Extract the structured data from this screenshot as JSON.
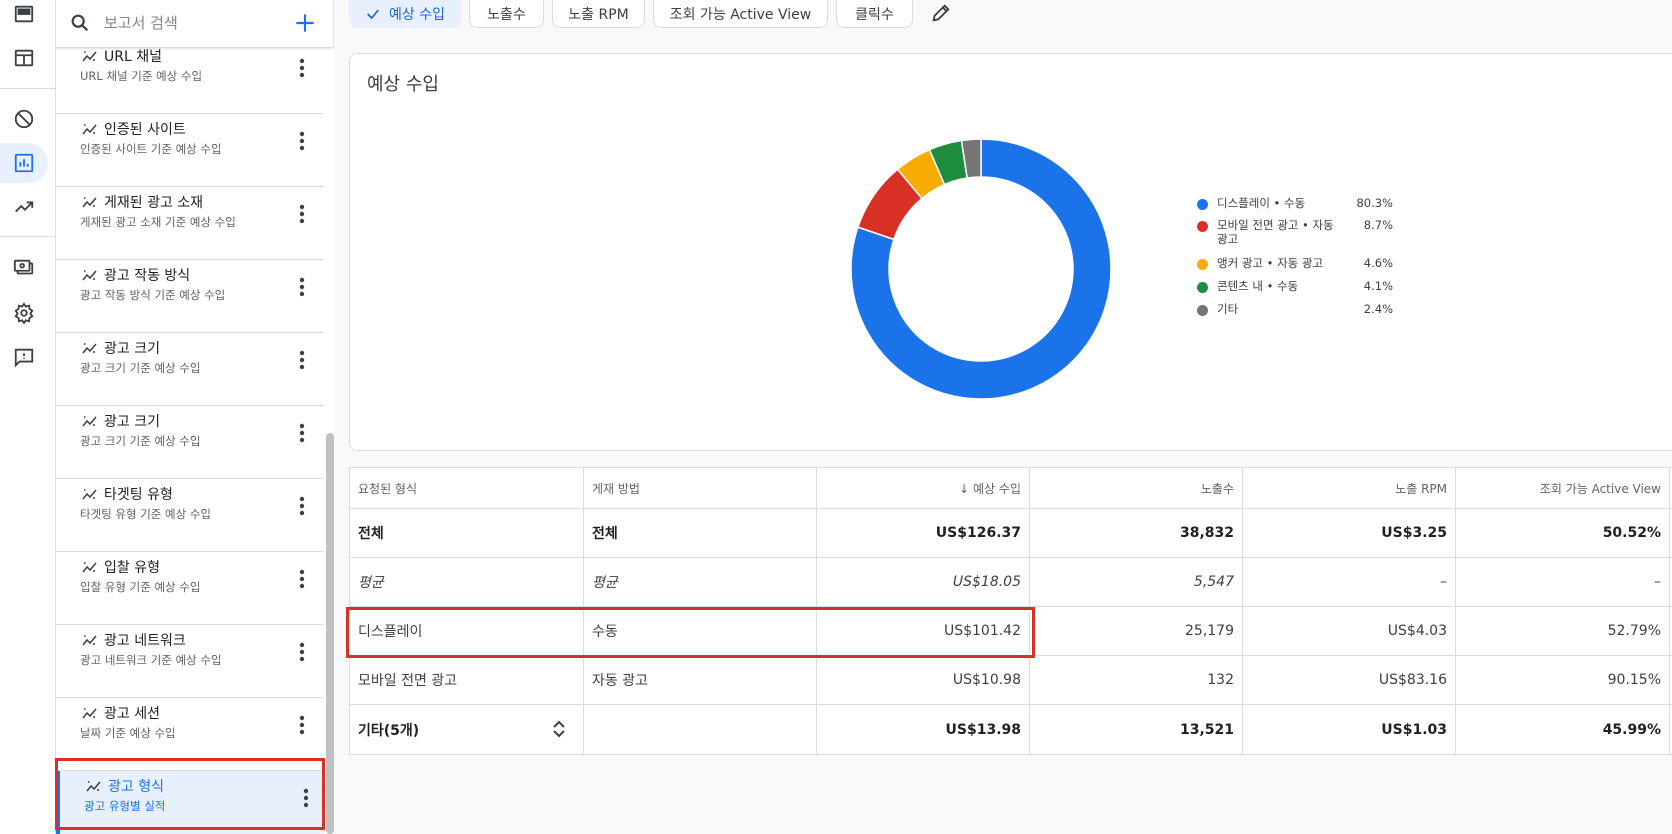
{
  "search": {
    "placeholder": "보고서 검색"
  },
  "reports": [
    {
      "title": "URL 채널",
      "subtitle": "URL 채널 기준 예상 수입"
    },
    {
      "title": "인증된 사이트",
      "subtitle": "인증된 사이트 기준 예상 수입"
    },
    {
      "title": "게재된 광고 소재",
      "subtitle": "게재된 광고 소재 기준 예상 수입"
    },
    {
      "title": "광고 작동 방식",
      "subtitle": "광고 작동 방식 기준 예상 수입"
    },
    {
      "title": "광고 크기",
      "subtitle": "광고 크기 기준 예상 수입"
    },
    {
      "title": "광고 크기",
      "subtitle": "광고 크기 기준 예상 수입"
    },
    {
      "title": "타겟팅 유형",
      "subtitle": "타겟팅 유형 기준 예상 수입"
    },
    {
      "title": "입찰 유형",
      "subtitle": "입찰 유형 기준 예상 수입"
    },
    {
      "title": "광고 네트워크",
      "subtitle": "광고 네트워크 기준 예상 수입"
    },
    {
      "title": "광고 세션",
      "subtitle": "날짜 기준 예상 수입"
    },
    {
      "title": "광고 형식",
      "subtitle": "광고 유형별 실적",
      "active": true
    }
  ],
  "chips": [
    "예상 수입",
    "노출수",
    "노출 RPM",
    "조회 가능 Active View",
    "클릭수"
  ],
  "card": {
    "title": "예상 수입"
  },
  "chart_data": {
    "type": "pie",
    "categories": [
      "디스플레이 • 수동",
      "모바일 전면 광고 • 자동 광고",
      "앵커 광고 • 자동 광고",
      "콘텐츠 내 • 수동",
      "기타"
    ],
    "values": [
      80.3,
      8.7,
      4.6,
      4.1,
      2.4
    ],
    "labels": [
      "80.3%",
      "8.7%",
      "4.6%",
      "4.1%",
      "2.4%"
    ],
    "colors": [
      "#1a73e8",
      "#d93025",
      "#f9ab00",
      "#1e8e3e",
      "#757575"
    ],
    "title": "예상 수입",
    "legend": "right"
  },
  "table": {
    "headers": [
      "요청된 형식",
      "게재 방법",
      "↓ 예상 수입",
      "노출수",
      "노출 RPM",
      "조회 가능 Active View"
    ],
    "rows": [
      {
        "cells": [
          "전체",
          "전체",
          "US$126.37",
          "38,832",
          "US$3.25",
          "50.52%"
        ],
        "style": "bold"
      },
      {
        "cells": [
          "평균",
          "평균",
          "US$18.05",
          "5,547",
          "–",
          "–"
        ],
        "style": "italic"
      },
      {
        "cells": [
          "디스플레이",
          "수동",
          "US$101.42",
          "25,179",
          "US$4.03",
          "52.79%"
        ],
        "style": "normal"
      },
      {
        "cells": [
          "모바일 전면 광고",
          "자동 광고",
          "US$10.98",
          "132",
          "US$83.16",
          "90.15%"
        ],
        "style": "normal"
      },
      {
        "cells": [
          "기타(5개)",
          "",
          "US$13.98",
          "13,521",
          "US$1.03",
          "45.99%"
        ],
        "style": "bold"
      }
    ]
  },
  "icons": [
    "search-icon",
    "add-icon",
    "sparkline-icon",
    "more-vert-icon",
    "check-icon",
    "edit-icon",
    "expand-icon"
  ]
}
